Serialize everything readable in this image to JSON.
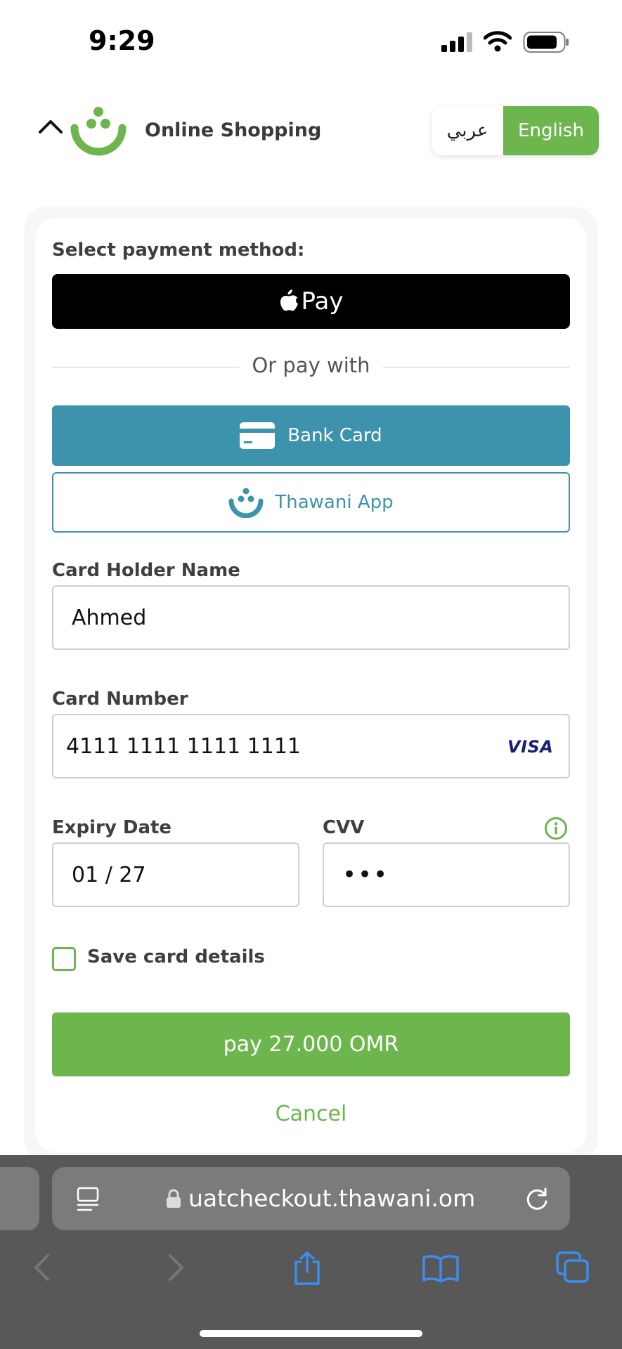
{
  "status_bar": {
    "time": "9:29"
  },
  "header": {
    "brand": "Online Shopping",
    "lang_arabic": "عربي",
    "lang_english": "English",
    "active_language": "English"
  },
  "payment": {
    "select_label": "Select payment method:",
    "apple_pay_label": "Pay",
    "or_text": "Or pay with",
    "bank_card_label": "Bank Card",
    "thawani_app_label": "Thawani App"
  },
  "form": {
    "holder_label": "Card Holder Name",
    "holder_value": "Ahmed",
    "number_label": "Card Number",
    "number_value": "4111 1111 1111 1111",
    "card_brand": "VISA",
    "expiry_label": "Expiry Date",
    "expiry_value": "01 / 27",
    "cvv_label": "CVV",
    "cvv_value": "•••",
    "save_label": "Save card details",
    "save_checked": false
  },
  "actions": {
    "pay_label": "pay 27.000 OMR",
    "cancel_label": "Cancel"
  },
  "browser": {
    "url": "uatcheckout.thawani.om"
  },
  "colors": {
    "brand_green": "#6db64e",
    "bank_blue": "#3d92ac"
  }
}
